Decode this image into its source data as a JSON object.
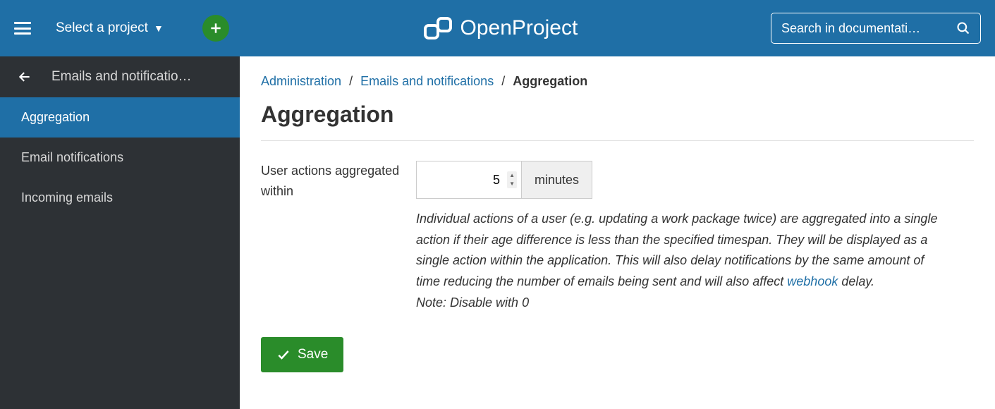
{
  "header": {
    "project_select_label": "Select a project",
    "search_placeholder": "Search in documentati…",
    "logo_text": "OpenProject"
  },
  "sidebar": {
    "title": "Emails and notificatio…",
    "items": [
      {
        "label": "Aggregation",
        "active": true
      },
      {
        "label": "Email notifications",
        "active": false
      },
      {
        "label": "Incoming emails",
        "active": false
      }
    ]
  },
  "breadcrumb": {
    "items": [
      {
        "label": "Administration",
        "link": true
      },
      {
        "label": "Emails and notifications",
        "link": true
      },
      {
        "label": "Aggregation",
        "link": false
      }
    ]
  },
  "page": {
    "title": "Aggregation",
    "form_label": "User actions aggregated within",
    "input_value": "5",
    "unit_label": "minutes",
    "help_text_pre": "Individual actions of a user (e.g. updating a work package twice) are aggregated into a single action if their age difference is less than the specified timespan. They will be displayed as a single action within the application. This will also delay notifications by the same amount of time reducing the number of emails being sent and will also affect ",
    "help_link": "webhook",
    "help_text_post": " delay.",
    "help_note": "Note: Disable with 0",
    "save_label": "Save"
  }
}
